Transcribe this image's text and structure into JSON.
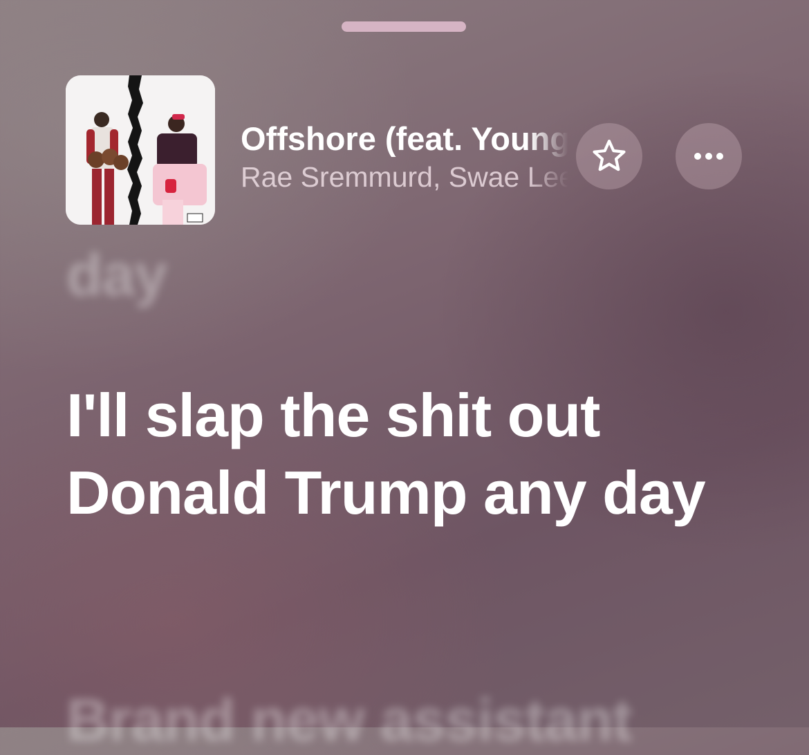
{
  "now_playing": {
    "title": "Offshore (feat. Young",
    "artist": "Rae Sremmurd, Swae Lee",
    "artwork_icon": "album-artwork"
  },
  "actions": {
    "favorite_icon": "star-icon",
    "more_icon": "ellipsis-icon"
  },
  "lyrics": {
    "previous": "day",
    "current": "I'll slap the shit out Donald Trump any day",
    "next": "Brand new assistant"
  },
  "colors": {
    "grabber": "#d6b4c4",
    "text": "#ffffff"
  }
}
